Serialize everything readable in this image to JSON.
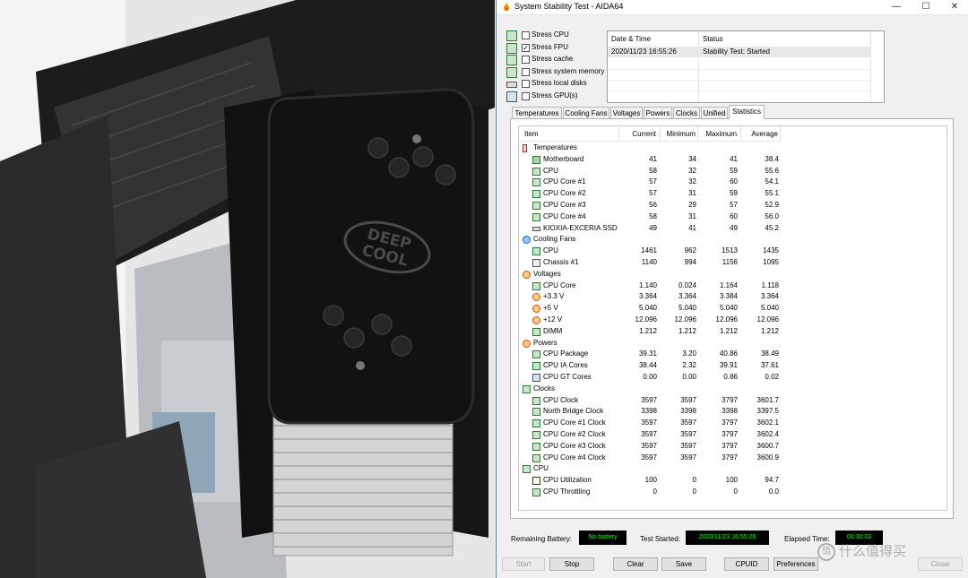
{
  "photo": {
    "brand_line1": "DEEP",
    "brand_line2": "COOL"
  },
  "window": {
    "title": "System Stability Test - AIDA64",
    "controls": {
      "minimize": "—",
      "maximize": "☐",
      "close": "✕"
    }
  },
  "stress_options": [
    {
      "label": "Stress CPU",
      "checked": false,
      "icon": "cpu-chip-icon"
    },
    {
      "label": "Stress FPU",
      "checked": true,
      "icon": "fpu-icon"
    },
    {
      "label": "Stress cache",
      "checked": false,
      "icon": "cache-icon"
    },
    {
      "label": "Stress system memory",
      "checked": false,
      "icon": "memory-icon"
    },
    {
      "label": "Stress local disks",
      "checked": false,
      "icon": "disk-icon"
    },
    {
      "label": "Stress GPU(s)",
      "checked": false,
      "icon": "gpu-monitor-icon"
    }
  ],
  "log": {
    "headers": {
      "datetime": "Date & Time",
      "status": "Status"
    },
    "rows": [
      {
        "datetime": "2020/11/23 16:55:26",
        "status": "Stability Test: Started"
      }
    ]
  },
  "tabs": [
    {
      "label": "Temperatures",
      "active": false
    },
    {
      "label": "Cooling Fans",
      "active": false
    },
    {
      "label": "Voltages",
      "active": false
    },
    {
      "label": "Powers",
      "active": false
    },
    {
      "label": "Clocks",
      "active": false
    },
    {
      "label": "Unified",
      "active": false
    },
    {
      "label": "Statistics",
      "active": true
    }
  ],
  "stats": {
    "headers": {
      "item": "Item",
      "current": "Current",
      "minimum": "Minimum",
      "maximum": "Maximum",
      "average": "Average"
    },
    "rows": [
      {
        "type": "group",
        "icon": "thermometer-icon",
        "name": "Temperatures"
      },
      {
        "icon": "motherboard-icon",
        "name": "Motherboard",
        "current": "41",
        "minimum": "34",
        "maximum": "41",
        "average": "38.4"
      },
      {
        "icon": "chip-icon",
        "name": "CPU",
        "current": "58",
        "minimum": "32",
        "maximum": "59",
        "average": "55.6"
      },
      {
        "icon": "chip-icon",
        "name": "CPU Core #1",
        "current": "57",
        "minimum": "32",
        "maximum": "60",
        "average": "54.1"
      },
      {
        "icon": "chip-icon",
        "name": "CPU Core #2",
        "current": "57",
        "minimum": "31",
        "maximum": "59",
        "average": "55.1"
      },
      {
        "icon": "chip-icon",
        "name": "CPU Core #3",
        "current": "56",
        "minimum": "29",
        "maximum": "57",
        "average": "52.9"
      },
      {
        "icon": "chip-icon",
        "name": "CPU Core #4",
        "current": "58",
        "minimum": "31",
        "maximum": "60",
        "average": "56.0"
      },
      {
        "icon": "ssd-icon",
        "name": "KIOXIA-EXCERIA SSD",
        "current": "49",
        "minimum": "41",
        "maximum": "49",
        "average": "45.2"
      },
      {
        "type": "group",
        "icon": "fan-icon",
        "name": "Cooling Fans"
      },
      {
        "icon": "chip-icon",
        "name": "CPU",
        "current": "1461",
        "minimum": "962",
        "maximum": "1513",
        "average": "1435"
      },
      {
        "icon": "chassis-icon",
        "name": "Chassis #1",
        "current": "1140",
        "minimum": "994",
        "maximum": "1156",
        "average": "1095"
      },
      {
        "type": "group",
        "icon": "voltage-icon",
        "name": "Voltages"
      },
      {
        "icon": "chip-icon",
        "name": "CPU Core",
        "current": "1.140",
        "minimum": "0.024",
        "maximum": "1.164",
        "average": "1.118"
      },
      {
        "icon": "voltage-icon",
        "name": "+3.3 V",
        "current": "3.364",
        "minimum": "3.364",
        "maximum": "3.384",
        "average": "3.364"
      },
      {
        "icon": "voltage-icon",
        "name": "+5 V",
        "current": "5.040",
        "minimum": "5.040",
        "maximum": "5.040",
        "average": "5.040"
      },
      {
        "icon": "voltage-icon",
        "name": "+12 V",
        "current": "12.096",
        "minimum": "12.096",
        "maximum": "12.096",
        "average": "12.096"
      },
      {
        "icon": "memory-icon",
        "name": "DIMM",
        "current": "1.212",
        "minimum": "1.212",
        "maximum": "1.212",
        "average": "1.212"
      },
      {
        "type": "group",
        "icon": "voltage-icon",
        "name": "Powers"
      },
      {
        "icon": "chip-icon",
        "name": "CPU Package",
        "current": "39.31",
        "minimum": "3.20",
        "maximum": "40.86",
        "average": "38.49"
      },
      {
        "icon": "chip-icon",
        "name": "CPU IA Cores",
        "current": "38.44",
        "minimum": "2.32",
        "maximum": "39.91",
        "average": "37.61"
      },
      {
        "icon": "gpu-icon",
        "name": "CPU GT Cores",
        "current": "0.00",
        "minimum": "0.00",
        "maximum": "0.86",
        "average": "0.02"
      },
      {
        "type": "group",
        "icon": "clock-icon",
        "name": "Clocks"
      },
      {
        "icon": "chip-icon",
        "name": "CPU Clock",
        "current": "3597",
        "minimum": "3597",
        "maximum": "3797",
        "average": "3601.7"
      },
      {
        "icon": "chip-icon",
        "name": "North Bridge Clock",
        "current": "3398",
        "minimum": "3398",
        "maximum": "3398",
        "average": "3397.5"
      },
      {
        "icon": "chip-icon",
        "name": "CPU Core #1 Clock",
        "current": "3597",
        "minimum": "3597",
        "maximum": "3797",
        "average": "3602.1"
      },
      {
        "icon": "chip-icon",
        "name": "CPU Core #2 Clock",
        "current": "3597",
        "minimum": "3597",
        "maximum": "3797",
        "average": "3602.4"
      },
      {
        "icon": "chip-icon",
        "name": "CPU Core #3 Clock",
        "current": "3597",
        "minimum": "3597",
        "maximum": "3797",
        "average": "3600.7"
      },
      {
        "icon": "chip-icon",
        "name": "CPU Core #4 Clock",
        "current": "3597",
        "minimum": "3597",
        "maximum": "3797",
        "average": "3600.9"
      },
      {
        "type": "group",
        "icon": "chip-icon",
        "name": "CPU"
      },
      {
        "icon": "hourglass-icon",
        "name": "CPU Utilization",
        "current": "100",
        "minimum": "0",
        "maximum": "100",
        "average": "94.7"
      },
      {
        "icon": "chip-icon",
        "name": "CPU Throttling",
        "current": "0",
        "minimum": "0",
        "maximum": "0",
        "average": "0.0"
      }
    ]
  },
  "status": {
    "battery_label": "Remaining Battery:",
    "battery_value": "No battery",
    "started_label": "Test Started:",
    "started_value": "2020/11/23 16:55:26",
    "elapsed_label": "Elapsed Time:",
    "elapsed_value": "00:30:03"
  },
  "buttons": {
    "start": "Start",
    "stop": "Stop",
    "clear": "Clear",
    "save": "Save",
    "cpuid": "CPUID",
    "preferences": "Preferences",
    "close": "Close"
  },
  "watermark": {
    "text": "什么值得买",
    "mark": "值"
  },
  "colors": {
    "accent": "#3b78d8",
    "readout_bg": "#000000",
    "readout_fg": "#00ff00",
    "window_bg": "#f0f0f0"
  }
}
